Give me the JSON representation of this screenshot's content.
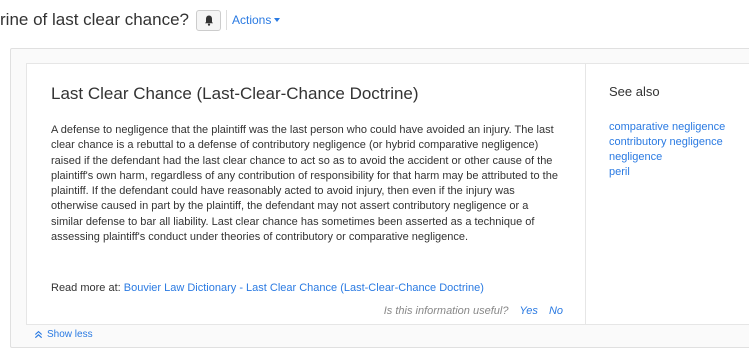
{
  "header": {
    "question_title": "rine of last clear chance?",
    "bell_icon": "bell-icon",
    "actions_label": "Actions"
  },
  "card": {
    "title": "Last Clear Chance (Last-Clear-Chance Doctrine)",
    "body": "A defense to negligence that the plaintiff was the last person who could have avoided an injury. The last clear chance is a rebuttal to a defense of contributory negligence (or hybrid comparative negligence) raised if the defendant had the last clear chance to act so as to avoid the accident or other cause of the plaintiff's own harm, regardless of any contribution of responsibility for that harm may be attributed to the plaintiff. If the defendant could have reasonably acted to avoid injury, then even if the injury was otherwise caused in part by the plaintiff, the defendant may not assert contributory negligence or a similar defense to bar all liability. Last clear chance has sometimes been asserted as a technique of assessing plaintiff's conduct under theories of contributory or comparative negligence.",
    "read_more_prefix": "Read more at: ",
    "read_more_link": "Bouvier Law Dictionary - Last Clear Chance (Last-Clear-Chance Doctrine)",
    "feedback_question": "Is this information useful?",
    "feedback_yes": "Yes",
    "feedback_no": "No"
  },
  "see_also": {
    "title": "See also",
    "links": [
      "comparative negligence",
      "contributory negligence",
      "negligence",
      "peril"
    ]
  },
  "footer": {
    "show_less": "Show less"
  },
  "colors": {
    "link": "#2a7ae2",
    "text": "#333333",
    "muted": "#888888"
  }
}
